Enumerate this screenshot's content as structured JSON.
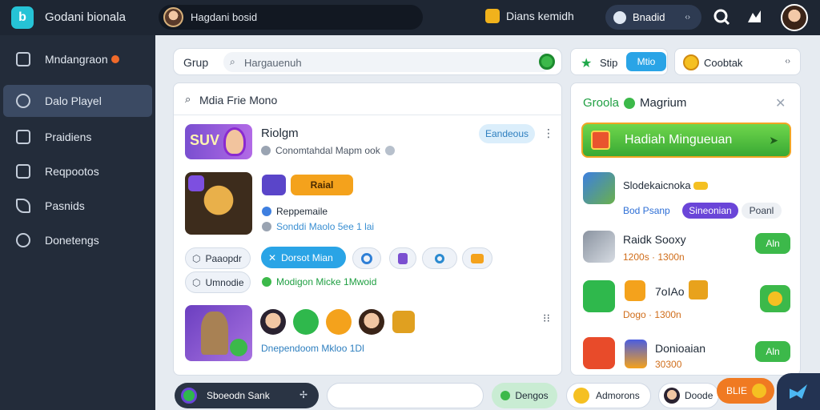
{
  "topbar": {
    "app_title": "Godani bionala",
    "search_text": "Hagdani bosid",
    "link_label": "Dians kemidh",
    "user_label": "Bnadid",
    "user_chevron": "‹›"
  },
  "sidebar": {
    "items": [
      {
        "label": "Mndangraon",
        "icon": "grid-icon"
      },
      {
        "label": "Dalo Playel",
        "icon": "controller-icon"
      },
      {
        "label": "Praidiens",
        "icon": "chart-icon"
      },
      {
        "label": "Reqpootos",
        "icon": "report-icon"
      },
      {
        "label": "Pasnids",
        "icon": "send-icon"
      },
      {
        "label": "Donetengs",
        "icon": "gear-icon"
      }
    ]
  },
  "group_bar": {
    "label": "Grup",
    "search_placeholder": "Hargauenuh"
  },
  "step": {
    "label": "Stip",
    "mode": "Mtio"
  },
  "coins": {
    "label": "Coobtak",
    "chevron": "‹›"
  },
  "feed": {
    "header": "Mdia Frie Mono",
    "row1": {
      "title": "Riolgm",
      "subtitle": "Conomtahdal Mapm ook",
      "pill": "Eandeous",
      "thumb_text": "SUV"
    },
    "row2": {
      "badge": "Raial",
      "line1": "Reppemaile",
      "line2": "Sonddi Maolo 5ee 1 lai"
    },
    "chips": {
      "chip1": "Paaopdr",
      "chip2": "Dorsot Mian",
      "chip3": "Umnodie",
      "status_line": "Modigon Micke 1Mwoid"
    },
    "row3": {
      "caption": "Dnependoom Mkloo 1Dl"
    }
  },
  "rewards": {
    "title_prefix": "Groola",
    "title_suffix": "Magrium",
    "banner": "Hadiah Mingueuan",
    "items": [
      {
        "title": "Slodekaicnoka",
        "tag1": "Bod Psanp",
        "tag2": "Sineonian",
        "tag3": "Poanl"
      },
      {
        "title": "Raidk Sooxy",
        "sub": "1200s · 1300n",
        "button": "Aln"
      },
      {
        "title": "7oIAo",
        "sub": "Dogo · 1300n",
        "button": ""
      },
      {
        "title": "Donioaian",
        "sub": "30300",
        "button": "Aln"
      }
    ]
  },
  "bottom": {
    "chip1": "Sboeodn Sank",
    "chip2_placeholder": "",
    "chip3": "Dengos",
    "chip4": "Admorons",
    "chip5": "Doode",
    "chip6": "BLIE"
  }
}
